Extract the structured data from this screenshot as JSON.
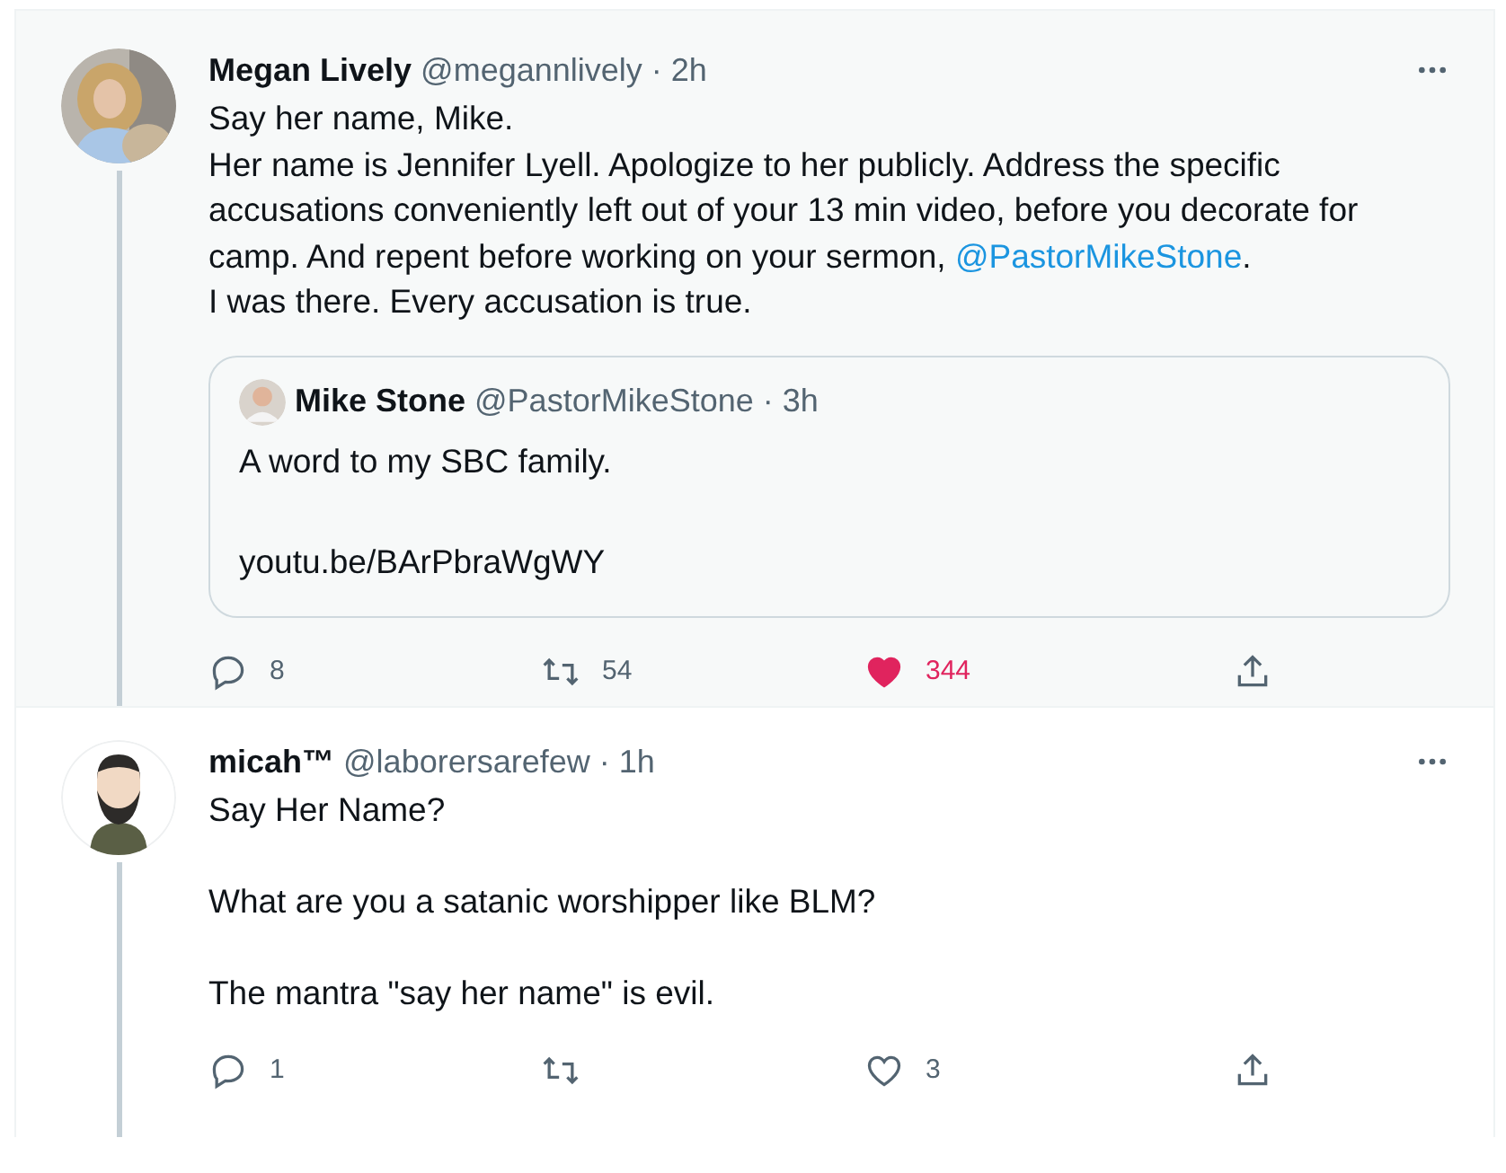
{
  "tweets": [
    {
      "name": "Megan Lively",
      "handle": "@megannlively",
      "time": "· 2h",
      "highlighted": true,
      "body": [
        {
          "kind": "text",
          "text": "Say her name, Mike.\nHer name is Jennifer Lyell. Apologize to her publicly. Address the specific accusations conveniently left out of your 13 min video, before you decorate for camp. And repent before working on your sermon, "
        },
        {
          "kind": "mention",
          "text": "@PastorMikeStone"
        },
        {
          "kind": "text",
          "text": ".\nI was there. Every accusation is true."
        }
      ],
      "quote": {
        "name": "Mike Stone",
        "handle": "@PastorMikeStone",
        "time": "· 3h",
        "text": "A word to my SBC family.\n\nyoutu.be/BArPbraWgWY"
      },
      "actions": {
        "replies": "8",
        "retweets": "54",
        "likes": "344",
        "liked": true
      }
    },
    {
      "name": "micah™",
      "handle": "@laborersarefew",
      "time": "· 1h",
      "highlighted": false,
      "avatar": {
        "kind": "cartoon"
      },
      "body": [
        {
          "kind": "text",
          "text": "Say Her Name?\n\nWhat are you a satanic worshipper like BLM?\n\nThe mantra \"say her name\" is evil."
        }
      ],
      "actions": {
        "replies": "1",
        "likes": "3",
        "liked": false
      }
    }
  ]
}
